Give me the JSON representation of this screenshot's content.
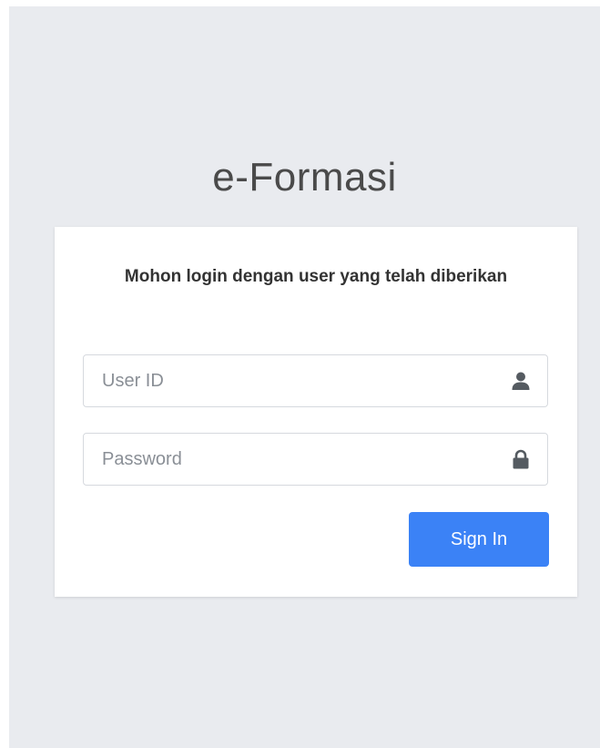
{
  "app": {
    "title": "e-Formasi"
  },
  "login": {
    "message": "Mohon login dengan user yang telah diberikan",
    "userid": {
      "value": "",
      "placeholder": "User ID",
      "icon": "user-icon"
    },
    "password": {
      "value": "",
      "placeholder": "Password",
      "icon": "lock-icon"
    },
    "signin_label": "Sign In"
  },
  "colors": {
    "page_background": "#e9ebef",
    "card_background": "#ffffff",
    "accent": "#3b82f6",
    "title_text": "#4a4a4a"
  }
}
